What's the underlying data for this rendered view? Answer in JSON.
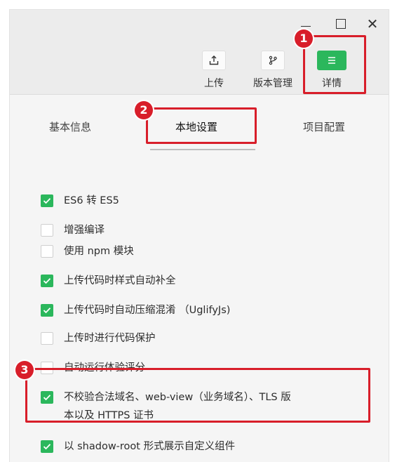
{
  "window": {
    "minimize_icon": "minimize-icon",
    "maximize_icon": "maximize-icon",
    "close_symbol": "✕"
  },
  "toolbar": {
    "upload_label": "上传",
    "version_label": "版本管理",
    "detail_label": "详情"
  },
  "tabs": [
    "基本信息",
    "本地设置",
    "项目配置"
  ],
  "options": [
    {
      "label": "ES6 转 ES5",
      "checked": true
    },
    {
      "label": "增强编译",
      "checked": false
    },
    {
      "label": "使用 npm 模块",
      "checked": false
    },
    {
      "label": "上传代码时样式自动补全",
      "checked": true
    },
    {
      "label": "上传代码时自动压缩混淆 （UglifyJs)",
      "checked": true
    },
    {
      "label": "上传时进行代码保护",
      "checked": false
    },
    {
      "label": "自动运行体验评分",
      "checked": false
    },
    {
      "label": "不校验合法域名、web-view（业务域名）、TLS 版",
      "label_line2": "本以及 HTTPS 证书",
      "checked": true
    },
    {
      "label": "以 shadow-root 形式展示自定义组件",
      "checked": true
    }
  ],
  "annotations": [
    "1",
    "2",
    "3"
  ],
  "colors": {
    "accent": "#2bb75c",
    "highlight": "#d81e2a"
  }
}
